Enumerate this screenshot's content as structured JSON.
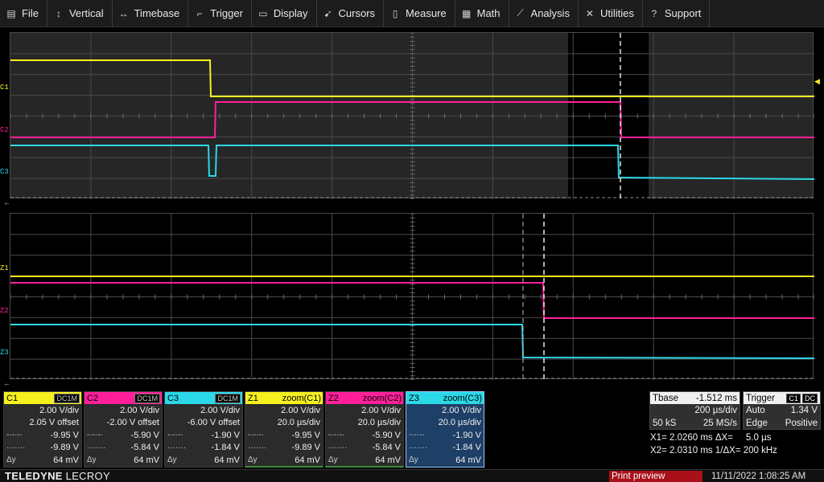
{
  "menu": [
    {
      "label": "File",
      "icon": "file-icon",
      "glyph": "▤"
    },
    {
      "label": "Vertical",
      "icon": "vertical-arrows-icon",
      "glyph": "↕"
    },
    {
      "label": "Timebase",
      "icon": "horizontal-arrows-icon",
      "glyph": "↔"
    },
    {
      "label": "Trigger",
      "icon": "trigger-icon",
      "glyph": "⌐"
    },
    {
      "label": "Display",
      "icon": "display-icon",
      "glyph": "▭"
    },
    {
      "label": "Cursors",
      "icon": "cursor-icon",
      "glyph": "➹"
    },
    {
      "label": "Measure",
      "icon": "measure-icon",
      "glyph": "▯"
    },
    {
      "label": "Math",
      "icon": "calculator-icon",
      "glyph": "▦"
    },
    {
      "label": "Analysis",
      "icon": "analysis-chart-icon",
      "glyph": "⟋"
    },
    {
      "label": "Utilities",
      "icon": "tools-icon",
      "glyph": "✕"
    },
    {
      "label": "Support",
      "icon": "help-icon",
      "glyph": "?"
    }
  ],
  "colors": {
    "c1": "#f5f01e",
    "c2": "#ff1f9a",
    "c3": "#2ad8e8",
    "background_top": "#262626",
    "background_bottom": "#000000",
    "active_box": "#1e3f66",
    "print_preview": "#a8101a"
  },
  "grid_labels": {
    "top": [
      "C1",
      "C2",
      "C3"
    ],
    "bottom": [
      "Z1",
      "Z2",
      "Z3"
    ]
  },
  "descriptors": [
    {
      "name": "C1",
      "tag": "DC1M",
      "color": "#f5f01e",
      "vdiv": "2.00 V/div",
      "offset": "2.05 V offset",
      "m1": "-9.95 V",
      "m2": "-9.89 V",
      "dy_label": "Δy",
      "dy": "64 mV",
      "kind": "channel"
    },
    {
      "name": "C2",
      "tag": "DC1M",
      "color": "#ff1f9a",
      "vdiv": "2.00 V/div",
      "offset": "-2.00 V offset",
      "m1": "-5.90 V",
      "m2": "-5.84 V",
      "dy_label": "Δy",
      "dy": "64 mV",
      "kind": "channel"
    },
    {
      "name": "C3",
      "tag": "DC1M",
      "color": "#2ad8e8",
      "vdiv": "2.00 V/div",
      "offset": "-6.00 V offset",
      "m1": "-1.90 V",
      "m2": "-1.84 V",
      "dy_label": "Δy",
      "dy": "64 mV",
      "kind": "channel"
    },
    {
      "name": "Z1",
      "tag": "zoom(C1)",
      "color": "#f5f01e",
      "vdiv": "2.00 V/div",
      "offset": "20.0 µs/div",
      "m1": "-9.95 V",
      "m2": "-9.89 V",
      "dy_label": "Δy",
      "dy": "64 mV",
      "kind": "zoom"
    },
    {
      "name": "Z2",
      "tag": "zoom(C2)",
      "color": "#ff1f9a",
      "vdiv": "2.00 V/div",
      "offset": "20.0 µs/div",
      "m1": "-5.90 V",
      "m2": "-5.84 V",
      "dy_label": "Δy",
      "dy": "64 mV",
      "kind": "zoom"
    },
    {
      "name": "Z3",
      "tag": "zoom(C3)",
      "color": "#2ad8e8",
      "vdiv": "2.00 V/div",
      "offset": "20.0 µs/div",
      "m1": "-1.90 V",
      "m2": "-1.84 V",
      "dy_label": "Δy",
      "dy": "64 mV",
      "kind": "zoom-active"
    }
  ],
  "timebase": {
    "label": "Tbase",
    "delay": "-1.512 ms",
    "per_div": "200 µs/div",
    "samples": "50 kS",
    "rate": "25 MS/s"
  },
  "trigger": {
    "label": "Trigger",
    "source": "C1",
    "coupling": "DC",
    "mode": "Auto",
    "level": "1.34 V",
    "type": "Edge",
    "slope": "Positive"
  },
  "cursors": {
    "line1": "X1= 2.0260 ms ΔX=     5.0 µs",
    "line2": "X2= 2.0310 ms 1/ΔX= 200 kHz"
  },
  "status": {
    "brand_bold": "TELEDYNE",
    "brand_rest": " LECROY",
    "print_preview": "Print preview",
    "datetime": "11/11/2022 1:08:25 AM"
  }
}
